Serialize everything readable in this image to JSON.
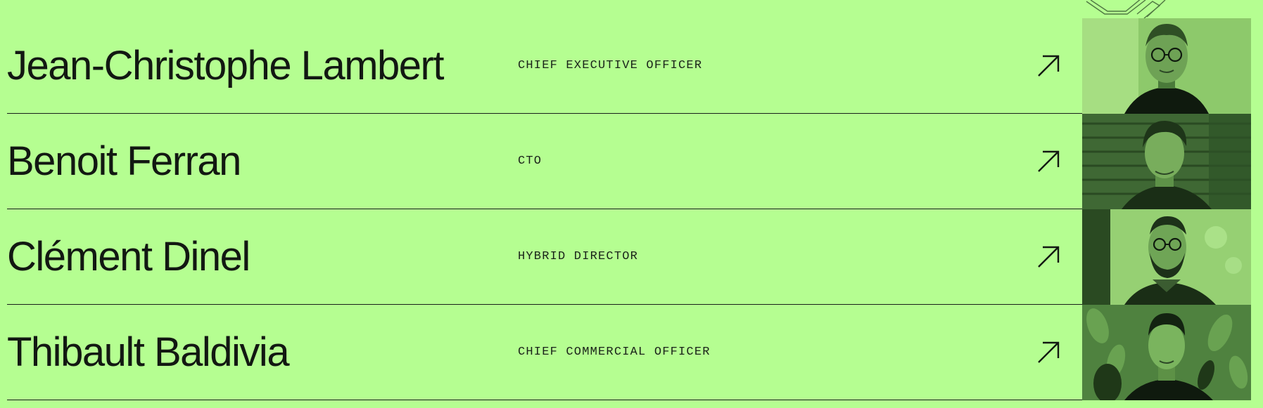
{
  "team": {
    "members": [
      {
        "name": "Jean-Christophe Lambert",
        "role": "CHIEF EXECUTIVE OFFICER",
        "link_icon": "arrow-up-right-icon",
        "photo": "portrait-photo"
      },
      {
        "name": "Benoit Ferran",
        "role": "CTO",
        "link_icon": "arrow-up-right-icon",
        "photo": "portrait-photo"
      },
      {
        "name": "Clément Dinel",
        "role": "HYBRID DIRECTOR",
        "link_icon": "arrow-up-right-icon",
        "photo": "portrait-photo"
      },
      {
        "name": "Thibault Baldivia",
        "role": "CHIEF COMMERCIAL OFFICER",
        "link_icon": "arrow-up-right-icon",
        "photo": "portrait-photo"
      }
    ]
  },
  "colors": {
    "background": "#b5fe91",
    "text": "#121812",
    "divider": "#17201a",
    "photo_tint": "#5d8a47"
  }
}
